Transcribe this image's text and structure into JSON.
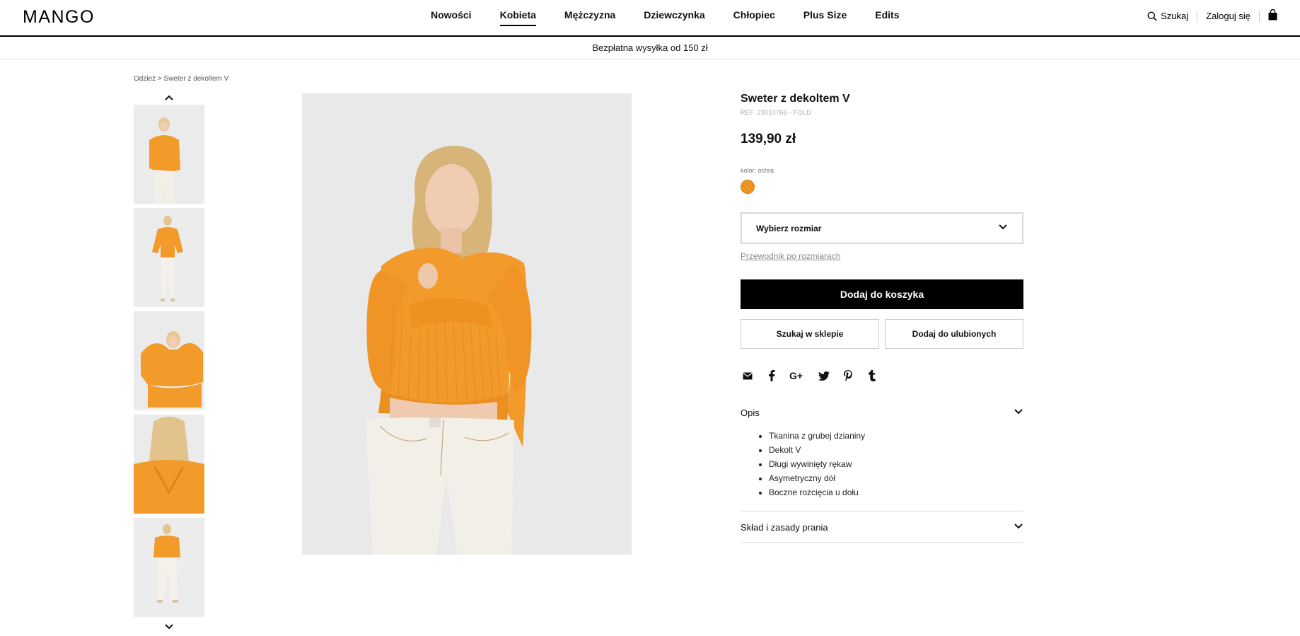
{
  "brand": {
    "logo": "MANGO"
  },
  "nav": {
    "items": [
      {
        "label": "Nowości",
        "active": false
      },
      {
        "label": "Kobieta",
        "active": true
      },
      {
        "label": "Mężczyzna",
        "active": false
      },
      {
        "label": "Dziewczynka",
        "active": false
      },
      {
        "label": "Chłopiec",
        "active": false
      },
      {
        "label": "Plus Size",
        "active": false
      },
      {
        "label": "Edits",
        "active": false
      }
    ],
    "search_label": "Szukaj",
    "login_label": "Zaloguj się",
    "icons": [
      "search-icon",
      "bag-icon"
    ]
  },
  "promo": {
    "text": "Bezpłatna wysyłka od 150 zł"
  },
  "breadcrumb": {
    "parent": "Odzież",
    "separator": ">",
    "current": "Sweter z dekoltem V"
  },
  "gallery": {
    "thumbnail_count": 5,
    "icons": [
      "chevron-up-icon",
      "chevron-down-icon"
    ]
  },
  "product": {
    "title": "Sweter z dekoltem V",
    "ref": "REF. 23010766 - FOLD",
    "price": "139,90 zł",
    "color_label": "kolor: ochra",
    "swatch_color": "#f29a2a",
    "size_select": "Wybierz rozmiar",
    "size_guide": "Przewodnik po rozmiarach",
    "add_to_cart": "Dodaj do koszyka",
    "find_in_store": "Szukaj w sklepie",
    "add_to_favorites": "Dodaj do ulubionych",
    "share_icons": [
      "email-icon",
      "facebook-icon",
      "google-plus-icon",
      "twitter-icon",
      "pinterest-icon",
      "tumblr-icon"
    ],
    "description": {
      "title": "Opis",
      "items": [
        "Tkanina z grubej dzianiny",
        "Dekolt V",
        "Długi wywinięty rękaw",
        "Asymetryczny dół",
        "Boczne rozcięcia u dołu"
      ]
    },
    "care": {
      "title": "Skład i zasady prania"
    }
  },
  "colors": {
    "accent": "#000000",
    "sweater": "#f29a2a",
    "jeans": "#f1ede6",
    "image_bg": "#e9e9ea"
  }
}
